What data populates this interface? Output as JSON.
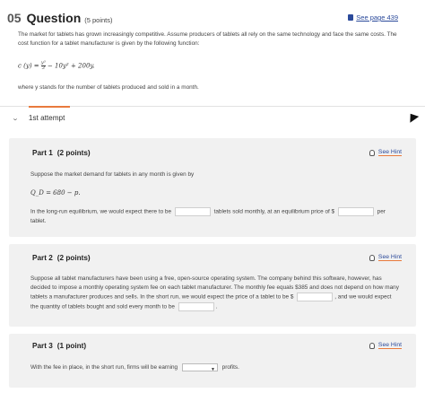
{
  "question": {
    "number": "05",
    "word": "Question",
    "points": "(5 points)",
    "see_page": "See page 439",
    "intro": "The market for tablets has grown increasingly competitive. Assume producers of tablets all rely on the same technology and face the same costs. The cost function for a tablet manufacturer is given by the following function:",
    "formula_lhs": "c (y) =",
    "formula_num": "y³",
    "formula_den": "3",
    "formula_rhs": "− 10y² + 200y.",
    "where": "where y stands for the number of tablets produced and sold in a month."
  },
  "attempt": {
    "label": "1st attempt",
    "accent_color": "#e97a3d"
  },
  "parts": [
    {
      "title": "Part 1",
      "points": "(2 points)",
      "hint": "See Hint",
      "demand_intro": "Suppose the market demand for tablets in any month is given by",
      "demand_eq": "Q_D = 680 − p.",
      "text_a": "In the long-run equilibrium, we would expect there to be",
      "text_b": "tablets sold monthly, at an equilibrium price of $",
      "text_c": "per tablet."
    },
    {
      "title": "Part 2",
      "points": "(2 points)",
      "hint": "See Hint",
      "text_a": "Suppose all tablet manufacturers have been using a free, open-source operating system. The company behind this software, however, has decided to impose a monthly operating system fee on each tablet manufacturer. The monthly fee equals $385 and does not depend on how many tablets a manufacturer produces and sells. In the short run, we would expect the price of a tablet to be $",
      "text_b": ",",
      "text_c": "and we would expect the quantity of tablets bought and sold every month to be",
      "text_d": "."
    },
    {
      "title": "Part 3",
      "points": "(1 point)",
      "hint": "See Hint",
      "text_a": "With the fee in place, in the short run, firms will be earning",
      "text_b": "profits."
    }
  ]
}
